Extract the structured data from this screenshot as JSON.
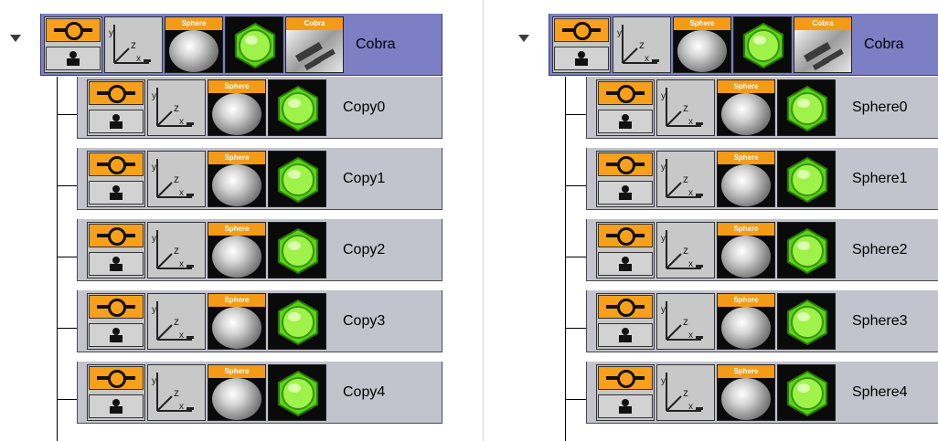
{
  "left_panel": {
    "root": {
      "label": "Cobra",
      "sphere_tag": "Sphere",
      "cobra_tag": "Cobra"
    },
    "children": [
      {
        "label": "Copy0",
        "sphere_tag": "Sphere"
      },
      {
        "label": "Copy1",
        "sphere_tag": "Sphere"
      },
      {
        "label": "Copy2",
        "sphere_tag": "Sphere"
      },
      {
        "label": "Copy3",
        "sphere_tag": "Sphere"
      },
      {
        "label": "Copy4",
        "sphere_tag": "Sphere"
      }
    ]
  },
  "right_panel": {
    "root": {
      "label": "Cobra",
      "sphere_tag": "Sphere",
      "cobra_tag": "Cobra"
    },
    "children": [
      {
        "label": "Sphere0",
        "sphere_tag": "Sphere"
      },
      {
        "label": "Sphere1",
        "sphere_tag": "Sphere"
      },
      {
        "label": "Sphere2",
        "sphere_tag": "Sphere"
      },
      {
        "label": "Sphere3",
        "sphere_tag": "Sphere"
      },
      {
        "label": "Sphere4",
        "sphere_tag": "Sphere"
      }
    ]
  },
  "icons": {
    "keyframe": "keyframe-icon",
    "transform": "transform-axis-icon",
    "material": "sphere-material-icon",
    "geometry": "green-hexagon-icon",
    "model": "cobra-model-icon"
  },
  "colors": {
    "root_bg": "#7c7fc4",
    "child_bg": "#c3c3cd",
    "keyframe_orange": "#f7a01c",
    "hex_green": "#66e21c"
  }
}
